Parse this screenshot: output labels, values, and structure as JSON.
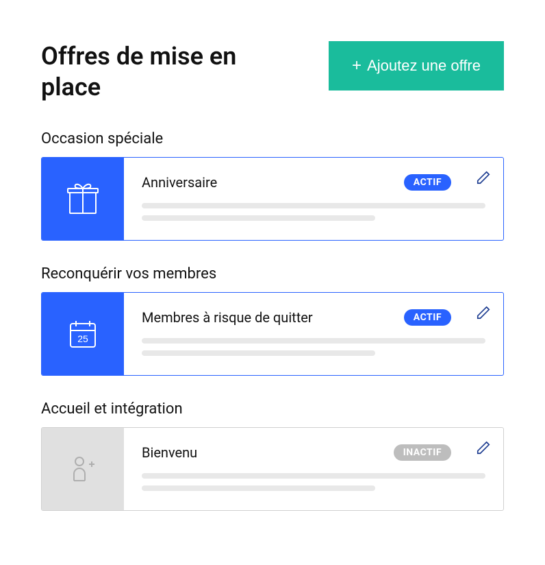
{
  "header": {
    "title": "Offres de mise en place",
    "add_button_label": "Ajoutez une offre"
  },
  "sections": [
    {
      "title": "Occasion spéciale",
      "card": {
        "title": "Anniversaire",
        "status": "ACTIF",
        "active": true,
        "icon": "gift-icon"
      }
    },
    {
      "title": "Reconquérir vos membres",
      "card": {
        "title": "Membres à risque de quitter",
        "status": "ACTIF",
        "active": true,
        "icon": "calendar-icon"
      }
    },
    {
      "title": "Accueil et intégration",
      "card": {
        "title": "Bienvenu",
        "status": "INACTIF",
        "active": false,
        "icon": "person-add-icon"
      }
    }
  ]
}
